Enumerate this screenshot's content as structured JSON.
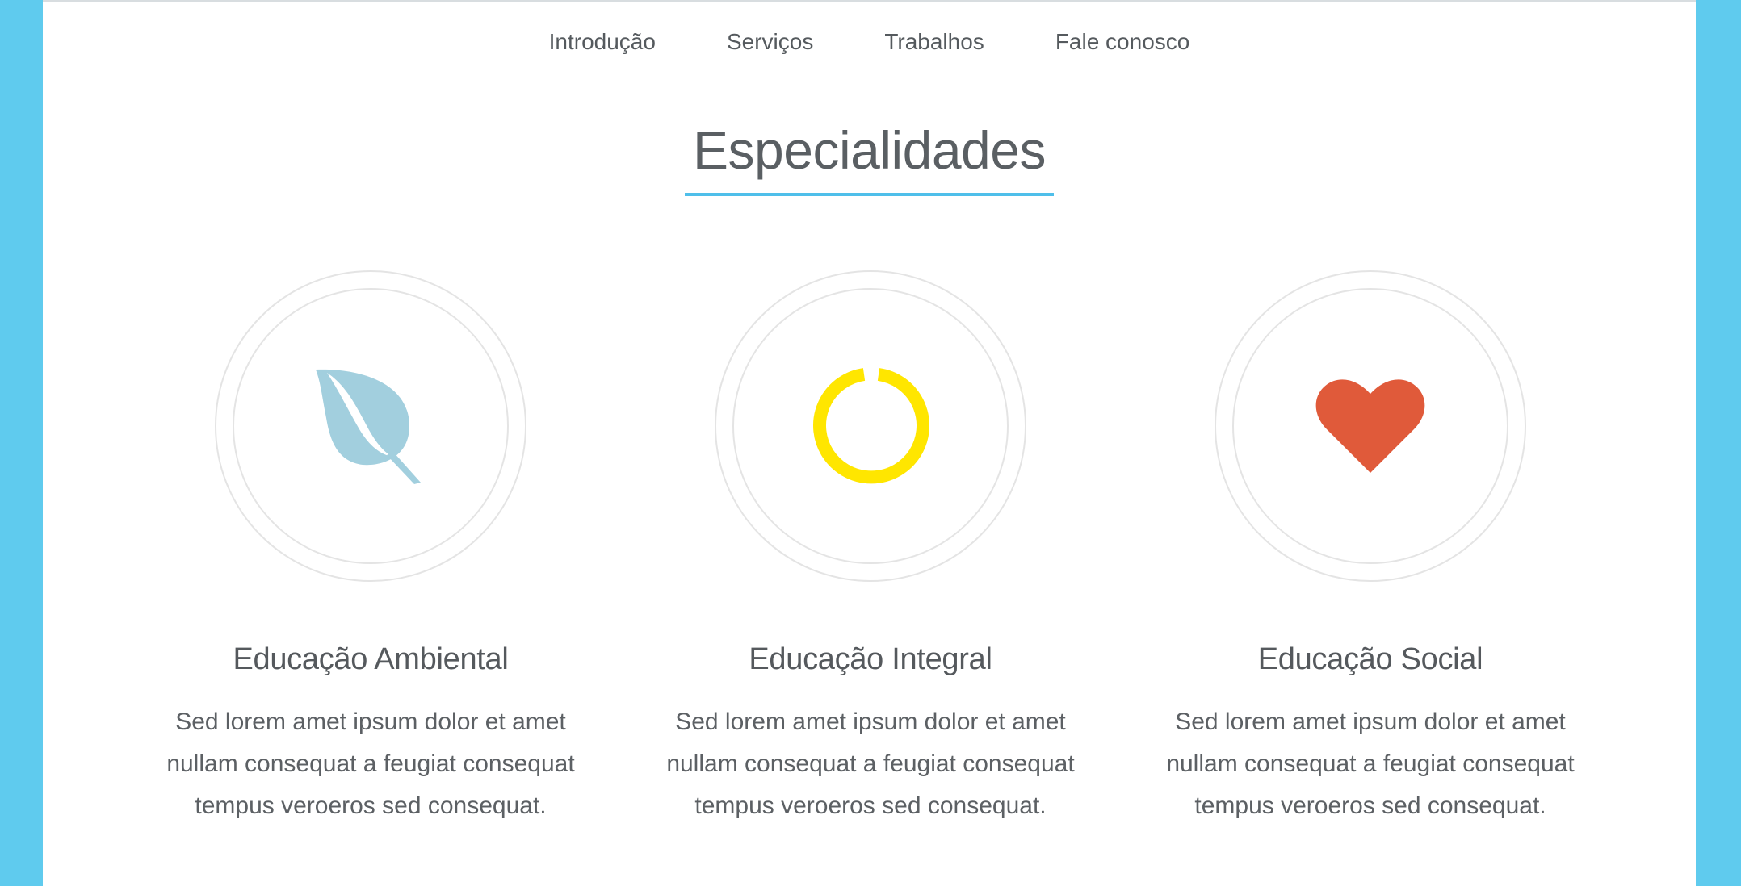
{
  "nav": {
    "items": [
      {
        "label": "Introdução"
      },
      {
        "label": "Serviços"
      },
      {
        "label": "Trabalhos"
      },
      {
        "label": "Fale conosco"
      }
    ]
  },
  "section": {
    "title": "Especialidades"
  },
  "features": [
    {
      "icon": "leaf-icon",
      "icon_color": "#a2cfde",
      "title": "Educação Ambiental",
      "text": "Sed lorem amet ipsum dolor et amet nullam consequat a feugiat consequat tempus veroeros sed consequat."
    },
    {
      "icon": "power-icon",
      "icon_color": "#ffe600",
      "title": "Educação Integral",
      "text": "Sed lorem amet ipsum dolor et amet nullam consequat a feugiat consequat tempus veroeros sed consequat."
    },
    {
      "icon": "heart-icon",
      "icon_color": "#e05a3a",
      "title": "Educação Social",
      "text": "Sed lorem amet ipsum dolor et amet nullam consequat a feugiat consequat tempus veroeros sed consequat."
    }
  ],
  "colors": {
    "background": "#5fcbee",
    "accent": "#4fbfea"
  }
}
